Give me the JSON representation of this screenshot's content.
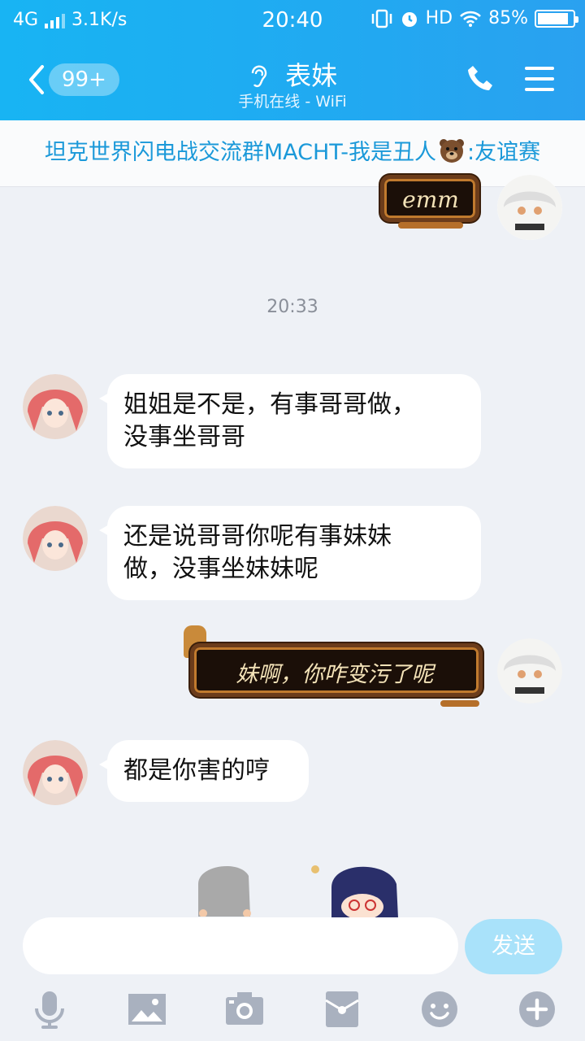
{
  "status": {
    "network": "4G",
    "speed": "3.1K/s",
    "time": "20:40",
    "hd": "HD",
    "battery": "85%"
  },
  "nav": {
    "back_badge": "99+",
    "title": "表妹",
    "subtitle": "手机在线 - WiFi"
  },
  "group_banner": {
    "before": "坦克世界闪电战交流群MACHT-我是丑人",
    "after": ":友谊赛"
  },
  "chat": {
    "time_divider": "20:33",
    "messages": [
      {
        "side": "me",
        "type": "sticker",
        "text": "emm"
      },
      {
        "side": "them",
        "type": "text",
        "lines": [
          "姐姐是不是，有事哥哥做，",
          "没事坐哥哥"
        ]
      },
      {
        "side": "them",
        "type": "text",
        "lines": [
          "还是说哥哥你呢有事妹妹",
          "做，没事坐妹妹呢"
        ]
      },
      {
        "side": "me",
        "type": "sticker",
        "text": "妹啊，你咋变污了呢"
      },
      {
        "side": "them",
        "type": "text",
        "lines": [
          "都是你害的哼"
        ]
      }
    ]
  },
  "composer": {
    "send": "发送"
  },
  "toolbar_icons": [
    "mic-icon",
    "image-icon",
    "camera-icon",
    "red-packet-icon",
    "emoji-icon",
    "plus-icon"
  ],
  "colors": {
    "header": "#21a9f1",
    "banner_text": "#1b99d9",
    "send_button": "#a9e2fa",
    "chat_bg": "#eef1f6"
  }
}
